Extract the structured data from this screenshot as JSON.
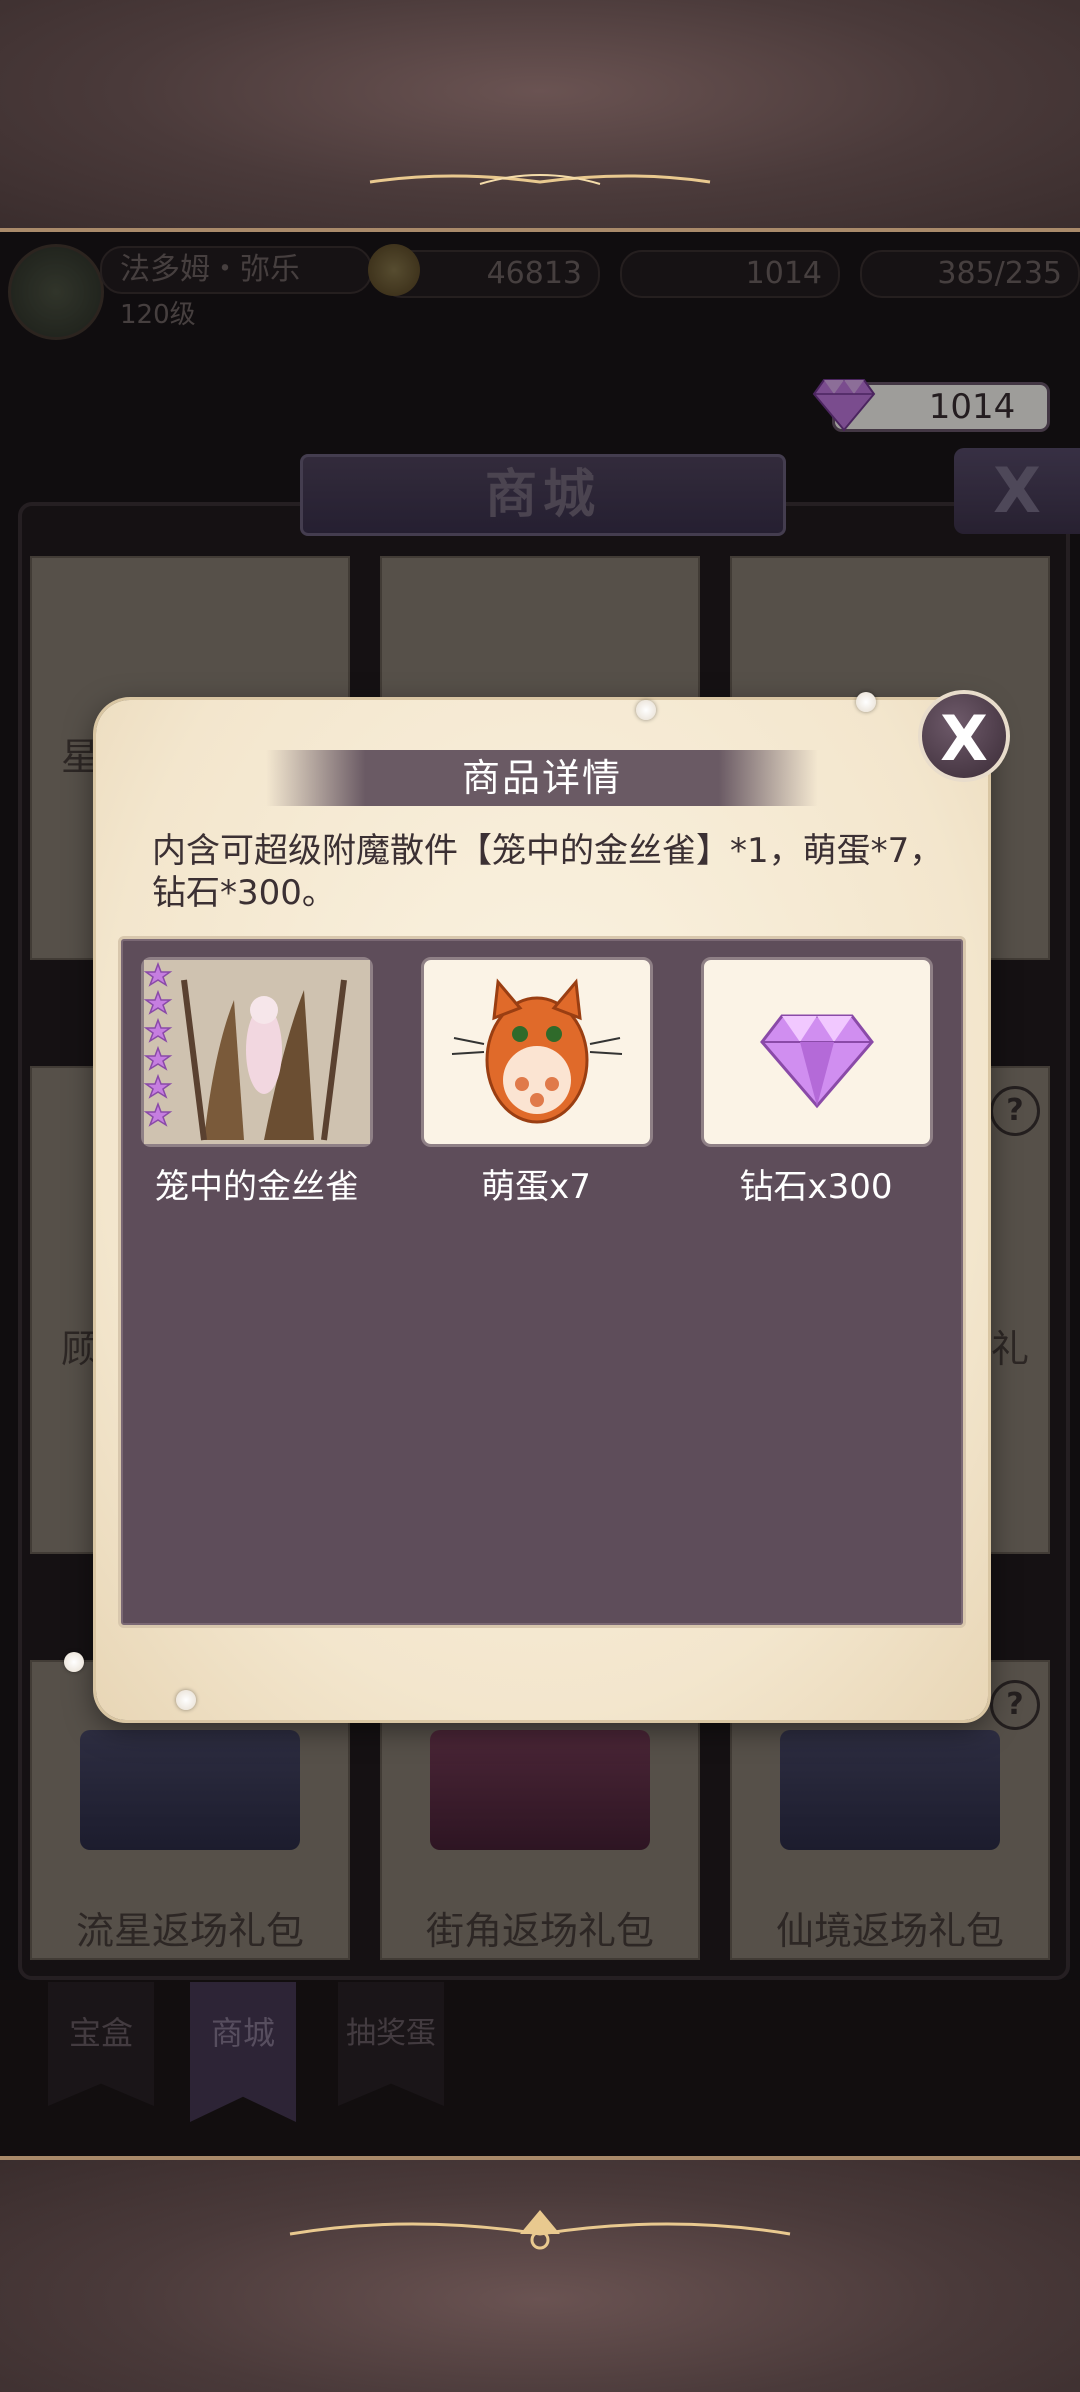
{
  "player": {
    "name": "法多姆・弥乐",
    "level": "120级",
    "coins": "46813",
    "gems": "1014",
    "tickets": "385/235"
  },
  "diamond_counter": "1014",
  "shop": {
    "title": "商城",
    "close_label": "X",
    "cards": [
      {
        "label": "星"
      },
      {
        "label": ""
      },
      {
        "label": ""
      },
      {
        "label": "顾"
      },
      {
        "label": ""
      },
      {
        "label": "礼"
      },
      {
        "label": "流星返场礼包"
      },
      {
        "label": "街角返场礼包"
      },
      {
        "label": "仙境返场礼包"
      }
    ],
    "help_label": "?"
  },
  "tabs": [
    {
      "label": "宝盒",
      "active": false
    },
    {
      "label": "商城",
      "active": true
    },
    {
      "label": "抽奖蛋",
      "active": false
    }
  ],
  "modal": {
    "title": "商品详情",
    "description": "内含可超级附魔散件【笼中的金丝雀】*1，萌蛋*7，钻石*300。",
    "close_label": "X",
    "items": [
      {
        "label": "笼中的金丝雀",
        "icon": "canary-cage-card-icon",
        "stars": 6
      },
      {
        "label": "萌蛋x7",
        "icon": "cat-egg-icon"
      },
      {
        "label": "钻石x300",
        "icon": "diamond-icon"
      }
    ]
  }
}
